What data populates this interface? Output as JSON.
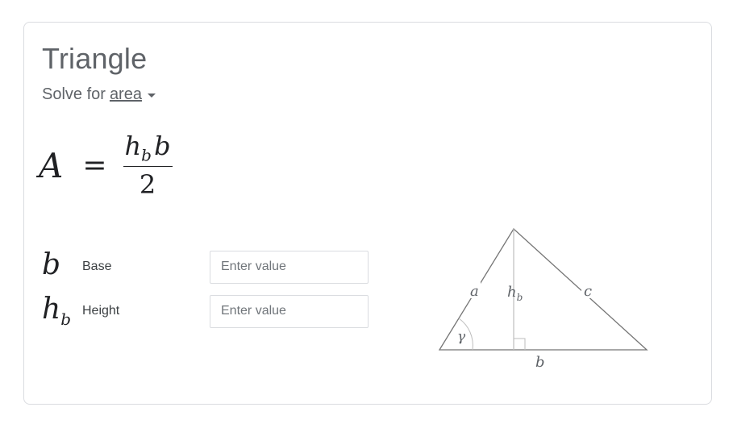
{
  "title": "Triangle",
  "solve": {
    "prefix": "Solve for",
    "target": "area"
  },
  "formula": {
    "lhs": "A",
    "eq": "=",
    "num_h": "h",
    "num_sub": "b",
    "num_b": "b",
    "den": "2"
  },
  "inputs": [
    {
      "symbol": "b",
      "sub": "",
      "label": "Base",
      "placeholder": "Enter value"
    },
    {
      "symbol": "h",
      "sub": "b",
      "label": "Height",
      "placeholder": "Enter value"
    }
  ],
  "diagram": {
    "side_a": "a",
    "side_c": "c",
    "side_b": "b",
    "height": "h",
    "height_sub": "b",
    "angle": "γ"
  },
  "colors": {
    "title": "#5f6368",
    "border": "#dadce0",
    "text": "#202124",
    "diagram": "#757575"
  }
}
